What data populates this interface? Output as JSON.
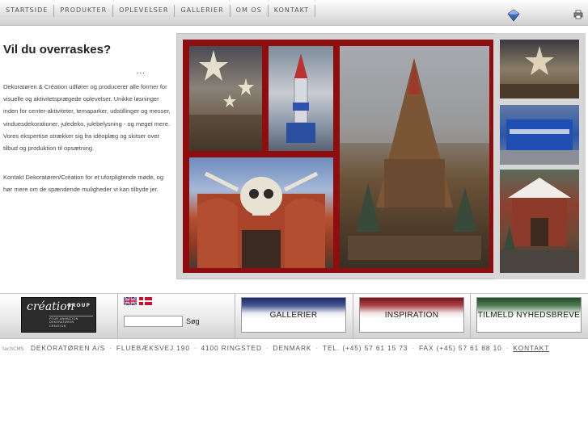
{
  "nav": {
    "items": [
      "STARTSIDE",
      "PRODUKTER",
      "OPLEVELSER",
      "GALLERIER",
      "OM OS",
      "KONTAKT"
    ],
    "icons": [
      "gem-icon",
      "print-icon"
    ]
  },
  "intro": {
    "headline": "Vil du overraskes?",
    "dots": "...",
    "paragraph1": "Dekoratøren & Création udfører og producerer alle former for visuelle og aktivitetsprægede oplevelser. Unikke løsninger inden for center-aktiviteter, temaparker, udstillinger og messer, vinduesdekorationer, juledeko, julebelysning - og meget mere. Vores ekspertise strækker sig fra idéoplæg og skitser over tilbud og produktion til opsætning.",
    "paragraph2": "Kontakt Dekoratøren/Création for et uforpligtende møde, og hør mere om de spændende muligheder vi kan tilbyde jer."
  },
  "logo": {
    "wordmark": "création",
    "group": "GROUP",
    "sub": [
      "FOUR ANIMATION",
      "DEKORATØREN",
      "CREATION"
    ]
  },
  "language": {
    "flags": [
      "uk-flag-icon",
      "dk-flag-icon"
    ]
  },
  "search": {
    "value": "",
    "button_label": "Søg"
  },
  "banners": {
    "gallerier": "GALLERIER",
    "inspiration": "INSPIRATION",
    "nyhedsbrev": "TILMELD NYHEDSBREVE"
  },
  "colors": {
    "collage_red": "#8e0e10",
    "banner_blue": "#1d2a6b",
    "banner_red": "#7a0f16",
    "banner_green": "#1f4d25"
  },
  "footer": {
    "cms": "techCMS",
    "company": "DEKORATØREN A/S",
    "street": "FLUEBÆKSVEJ 190",
    "city": "4100 RINGSTED",
    "country": "DENMARK",
    "phone": "TEL. (+45) 57 61 15 73",
    "fax": "FAX (+45) 57 61 88 10",
    "contact_link": "KONTAKT"
  }
}
